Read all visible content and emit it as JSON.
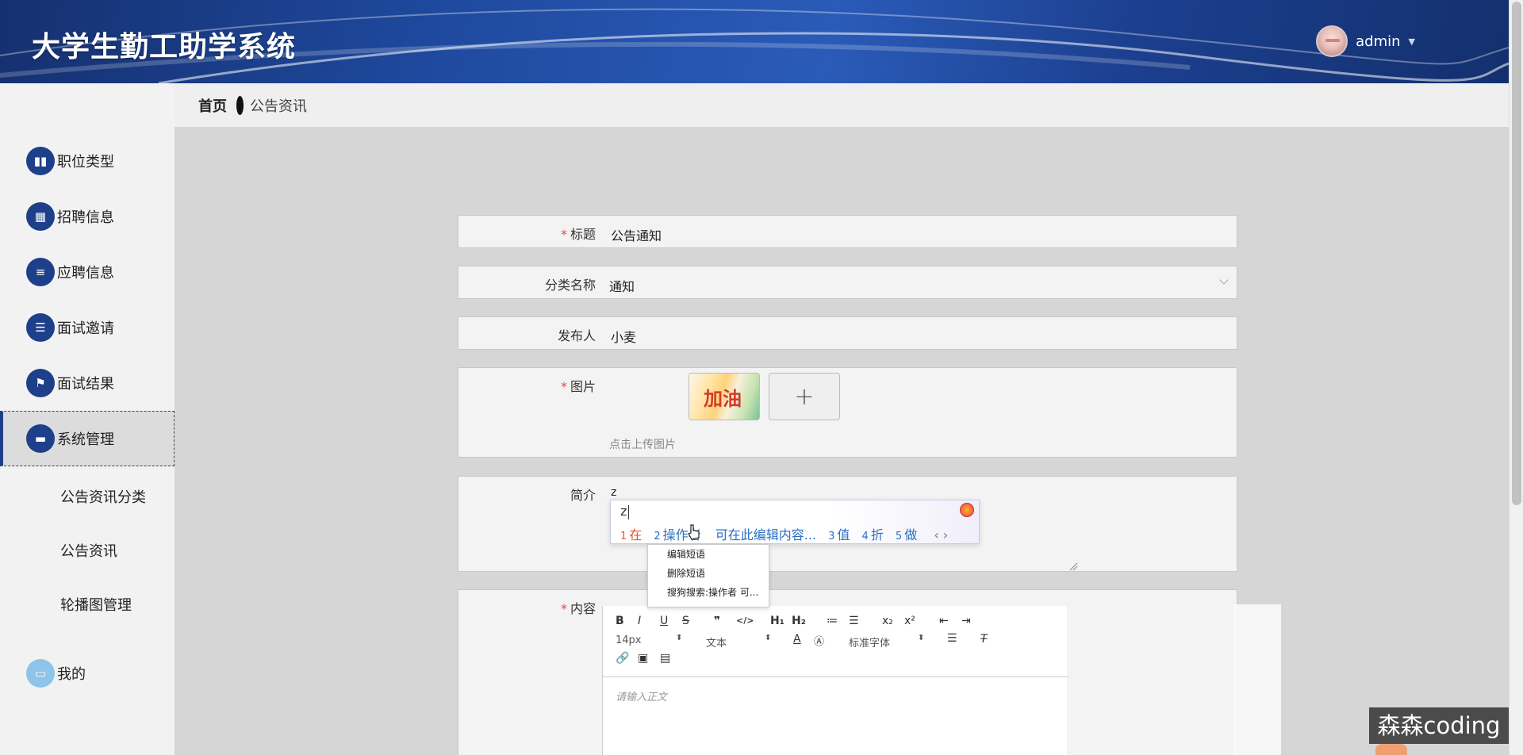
{
  "header": {
    "app_title": "大学生勤工助学系统",
    "username": "admin",
    "caret": "▼"
  },
  "sidebar": {
    "items": [
      {
        "label": "职位类型",
        "icon": "book-icon",
        "glyph": "▮▮"
      },
      {
        "label": "招聘信息",
        "icon": "grid-icon",
        "glyph": "▦"
      },
      {
        "label": "应聘信息",
        "icon": "list-icon",
        "glyph": "≡"
      },
      {
        "label": "面试邀请",
        "icon": "indent-list-icon",
        "glyph": "☰"
      },
      {
        "label": "面试结果",
        "icon": "flag-icon",
        "glyph": "⚑"
      },
      {
        "label": "系统管理",
        "icon": "monitor-icon",
        "glyph": "▬"
      }
    ],
    "sub_items": [
      {
        "label": "公告资讯分类"
      },
      {
        "label": "公告资讯"
      },
      {
        "label": "轮播图管理"
      }
    ],
    "mine": {
      "label": "我的",
      "icon": "card-icon",
      "glyph": "▭"
    }
  },
  "breadcrumb": {
    "home": "首页",
    "current": "公告资讯"
  },
  "form": {
    "title": {
      "label": "标题",
      "required": "*",
      "value": "公告通知"
    },
    "category": {
      "label": "分类名称",
      "value": "通知"
    },
    "publisher": {
      "label": "发布人",
      "value": "小麦"
    },
    "image": {
      "label": "图片",
      "required": "*",
      "upload_hint": "点击上传图片",
      "plus": "+",
      "thumb_text": "加油"
    },
    "summary": {
      "label": "简介",
      "value": "z"
    },
    "content": {
      "label": "内容",
      "required": "*"
    }
  },
  "ime": {
    "composition": "z",
    "candidates": [
      {
        "num": "1",
        "text": "在"
      },
      {
        "num": "2",
        "text": "操作者"
      },
      {
        "num": "",
        "text": "可在此编辑内容..."
      },
      {
        "num": "3",
        "text": "值"
      },
      {
        "num": "4",
        "text": "折"
      },
      {
        "num": "5",
        "text": "做"
      }
    ],
    "arrows": "‹ ›"
  },
  "context_menu": {
    "items": [
      "编辑短语",
      "删除短语",
      "搜狗搜索:操作者   可..."
    ]
  },
  "editor": {
    "buttons": [
      "B",
      "I",
      "U",
      "S",
      "❞",
      "</>",
      "H₁",
      "H₂",
      "≔",
      "☰",
      "x₂",
      "x²",
      "⇤",
      "⇥"
    ],
    "font_size": "14px",
    "block_type": "文本",
    "font_family": "标准字体",
    "placeholder": "请输入正文"
  },
  "watermark": "森森coding"
}
